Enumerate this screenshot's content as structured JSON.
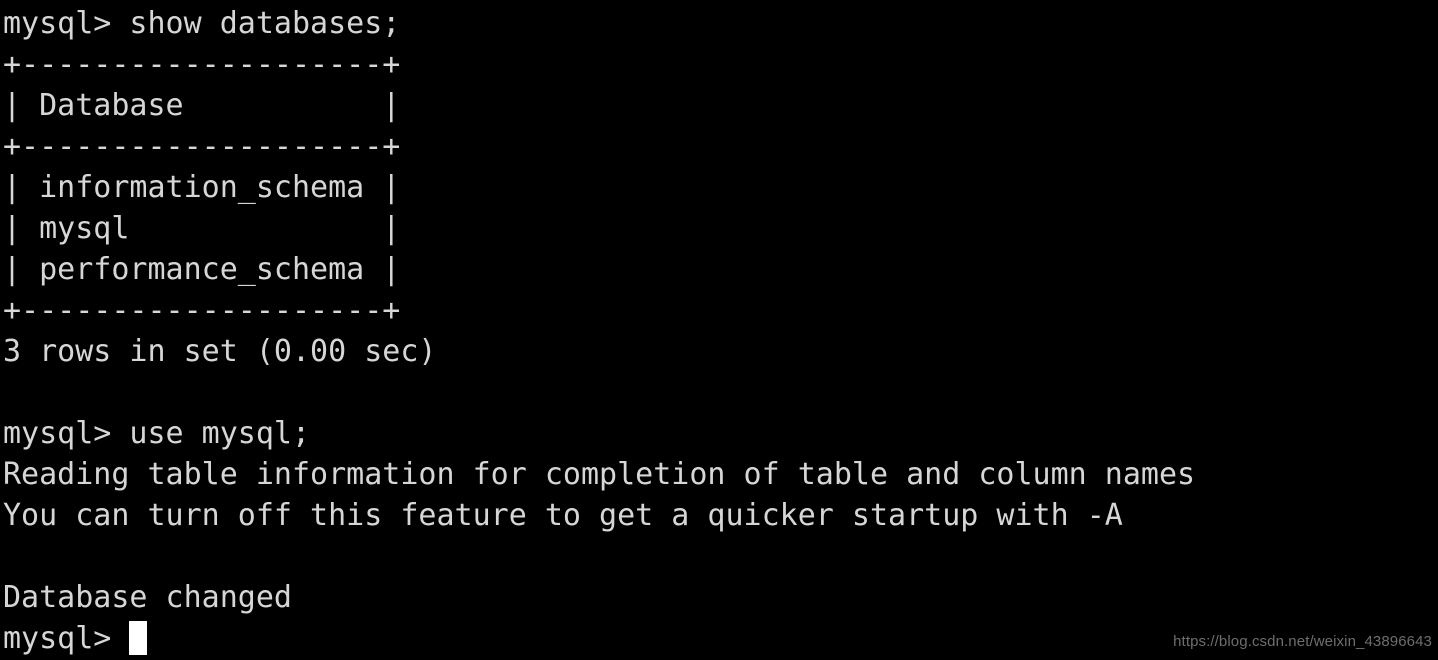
{
  "terminal": {
    "background_color": "#000000",
    "text_color": "#d6d6d6",
    "cursor_color": "#ffffff",
    "prompt": "mysql> ",
    "lines": [
      {
        "id": "cmd-show-databases",
        "text": "mysql> show databases;"
      },
      {
        "id": "table-top-border",
        "text": "+--------------------+"
      },
      {
        "id": "table-header-row",
        "text": "| Database           |"
      },
      {
        "id": "table-header-rule",
        "text": "+--------------------+"
      },
      {
        "id": "row-information-schema",
        "text": "| information_schema |"
      },
      {
        "id": "row-mysql",
        "text": "| mysql              |"
      },
      {
        "id": "row-performance-schema",
        "text": "| performance_schema |"
      },
      {
        "id": "table-bottom-border",
        "text": "+--------------------+"
      },
      {
        "id": "result-summary",
        "text": "3 rows in set (0.00 sec)"
      },
      {
        "id": "blank-1",
        "text": " "
      },
      {
        "id": "cmd-use-mysql",
        "text": "mysql> use mysql;"
      },
      {
        "id": "notice-reading-table",
        "text": "Reading table information for completion of table and column names"
      },
      {
        "id": "notice-turn-off",
        "text": "You can turn off this feature to get a quicker startup with -A"
      },
      {
        "id": "blank-2",
        "text": " "
      },
      {
        "id": "status-database-changed",
        "text": "Database changed"
      }
    ],
    "final_prompt": "mysql> "
  },
  "table": {
    "columns": [
      "Database"
    ],
    "rows": [
      [
        "information_schema"
      ],
      [
        "mysql"
      ],
      [
        "performance_schema"
      ]
    ],
    "row_count_text": "3 rows in set (0.00 sec)",
    "row_count": 3,
    "query_time_sec": "0.00"
  },
  "watermark": {
    "text": "https://blog.csdn.net/weixin_43896643",
    "color": "#6e6e6e"
  }
}
